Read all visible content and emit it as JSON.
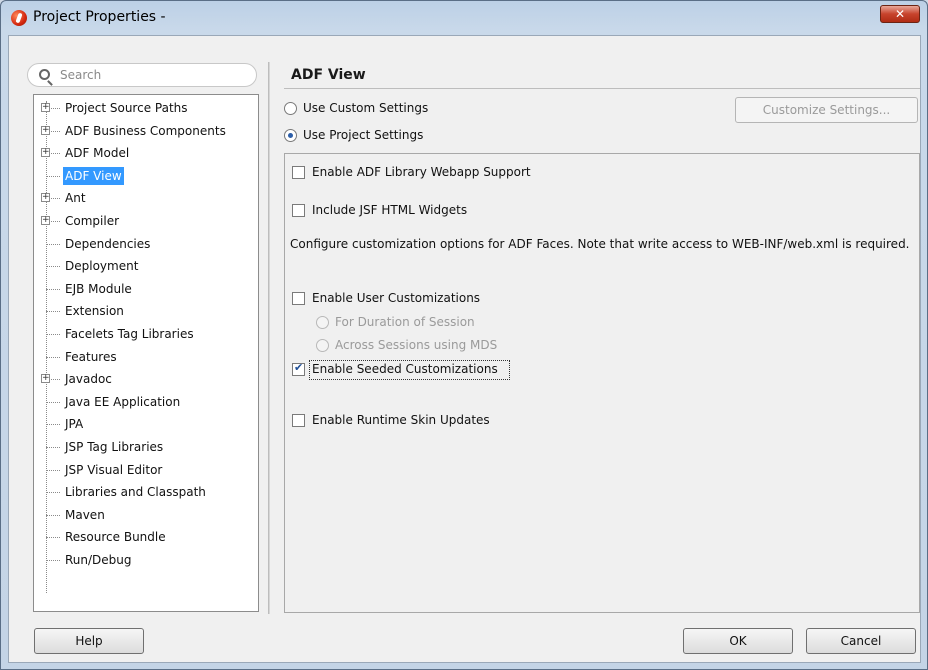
{
  "window": {
    "title": "Project Properties -",
    "close_label": "✕"
  },
  "search": {
    "placeholder": "Search"
  },
  "tree": {
    "items": [
      {
        "label": "Project Source Paths",
        "expandable": true
      },
      {
        "label": "ADF Business Components",
        "expandable": true
      },
      {
        "label": "ADF Model",
        "expandable": true
      },
      {
        "label": "ADF View",
        "expandable": false,
        "selected": true
      },
      {
        "label": "Ant",
        "expandable": true
      },
      {
        "label": "Compiler",
        "expandable": true
      },
      {
        "label": "Dependencies",
        "expandable": false
      },
      {
        "label": "Deployment",
        "expandable": false
      },
      {
        "label": "EJB Module",
        "expandable": false
      },
      {
        "label": "Extension",
        "expandable": false
      },
      {
        "label": "Facelets Tag Libraries",
        "expandable": false
      },
      {
        "label": "Features",
        "expandable": false
      },
      {
        "label": "Javadoc",
        "expandable": true
      },
      {
        "label": "Java EE Application",
        "expandable": false
      },
      {
        "label": "JPA",
        "expandable": false
      },
      {
        "label": "JSP Tag Libraries",
        "expandable": false
      },
      {
        "label": "JSP Visual Editor",
        "expandable": false
      },
      {
        "label": "Libraries and Classpath",
        "expandable": false
      },
      {
        "label": "Maven",
        "expandable": false
      },
      {
        "label": "Resource Bundle",
        "expandable": false
      },
      {
        "label": "Run/Debug",
        "expandable": false
      }
    ]
  },
  "panel": {
    "title": "ADF View",
    "use_custom_label": "Use Custom Settings",
    "use_project_label": "Use Project Settings",
    "customize_button": "Customize Settings...",
    "enable_adf_library_label": "Enable ADF Library Webapp Support",
    "include_jsf_label": "Include JSF HTML Widgets",
    "description": "Configure customization options for ADF Faces. Note that write access to WEB-INF/web.xml is required.",
    "enable_user_customizations_label": "Enable User Customizations",
    "duration_of_session_label": "For Duration of Session",
    "across_sessions_label": "Across Sessions using MDS",
    "enable_seeded_label": "Enable Seeded Customizations",
    "enable_runtime_skin_label": "Enable Runtime Skin Updates",
    "state": {
      "use_project_settings": true,
      "enable_adf_library": false,
      "include_jsf": false,
      "enable_user_customizations": false,
      "enable_seeded": true,
      "enable_runtime_skin": false
    }
  },
  "footer": {
    "help_label": "Help",
    "ok_label": "OK",
    "cancel_label": "Cancel"
  }
}
